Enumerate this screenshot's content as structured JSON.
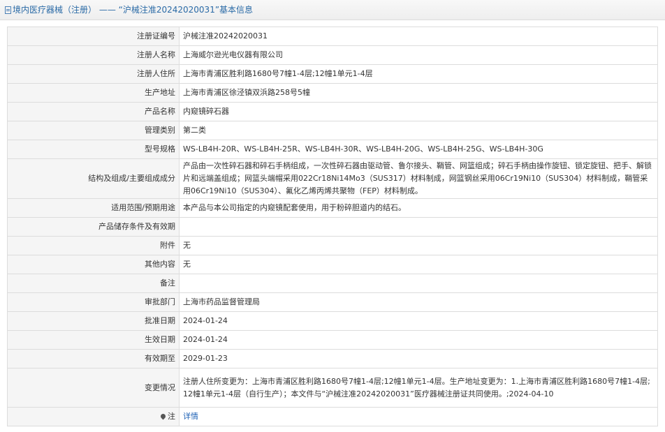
{
  "header": {
    "title": "境内医疗器械（注册） —— “沪械注准20242020031”基本信息"
  },
  "rows": [
    {
      "label": "注册证编号",
      "value": "沪械注准20242020031"
    },
    {
      "label": "注册人名称",
      "value": "上海威尔逊光电仪器有限公司"
    },
    {
      "label": "注册人住所",
      "value": "上海市青浦区胜利路1680号7幢1-4层;12幢1单元1-4层"
    },
    {
      "label": "生产地址",
      "value": "上海市青浦区徐泾镇双浜路258号5幢"
    },
    {
      "label": "产品名称",
      "value": "内窥镜碎石器"
    },
    {
      "label": "管理类别",
      "value": "第二类"
    },
    {
      "label": "型号规格",
      "value": "WS-LB4H-20R、WS-LB4H-25R、WS-LB4H-30R、WS-LB4H-20G、WS-LB4H-25G、WS-LB4H-30G"
    },
    {
      "label": "结构及组成/主要组成成分",
      "value": "产品由一次性碎石器和碎石手柄组成，一次性碎石器由驱动管、鲁尔接头、鞘管、网篮组成；碎石手柄由操作旋钮、锁定旋钮、把手、解锁片和远端盖组成；网篮头端帽采用022Cr18Ni14Mo3（SUS317）材料制成，网篮钢丝采用06Cr19Ni10（SUS304）材料制成，鞘管采用06Cr19Ni10（SUS304）、氟化乙烯丙烯共聚物（FEP）材料制成。"
    },
    {
      "label": "适用范围/预期用途",
      "value": "本产品与本公司指定的内窥镜配套使用，用于粉碎胆道内的结石。"
    },
    {
      "label": "产品储存条件及有效期",
      "value": ""
    },
    {
      "label": "附件",
      "value": "无"
    },
    {
      "label": "其他内容",
      "value": "无"
    },
    {
      "label": "备注",
      "value": ""
    },
    {
      "label": "审批部门",
      "value": "上海市药品监督管理局"
    },
    {
      "label": "批准日期",
      "value": "2024-01-24"
    },
    {
      "label": "生效日期",
      "value": "2024-01-24"
    },
    {
      "label": "有效期至",
      "value": "2029-01-23"
    },
    {
      "label": "变更情况",
      "value": "注册人住所变更为：上海市青浦区胜利路1680号7幢1-4层;12幢1单元1-4层。生产地址变更为：1.上海市青浦区胜利路1680号7幢1-4层;12幢1单元1-4层（自行生产）；本文件与“沪械注准20242020031”医疗器械注册证共同使用。;2024-04-10"
    }
  ],
  "note": {
    "label": "注",
    "link_text": "详情",
    "icon": "pin-icon"
  }
}
